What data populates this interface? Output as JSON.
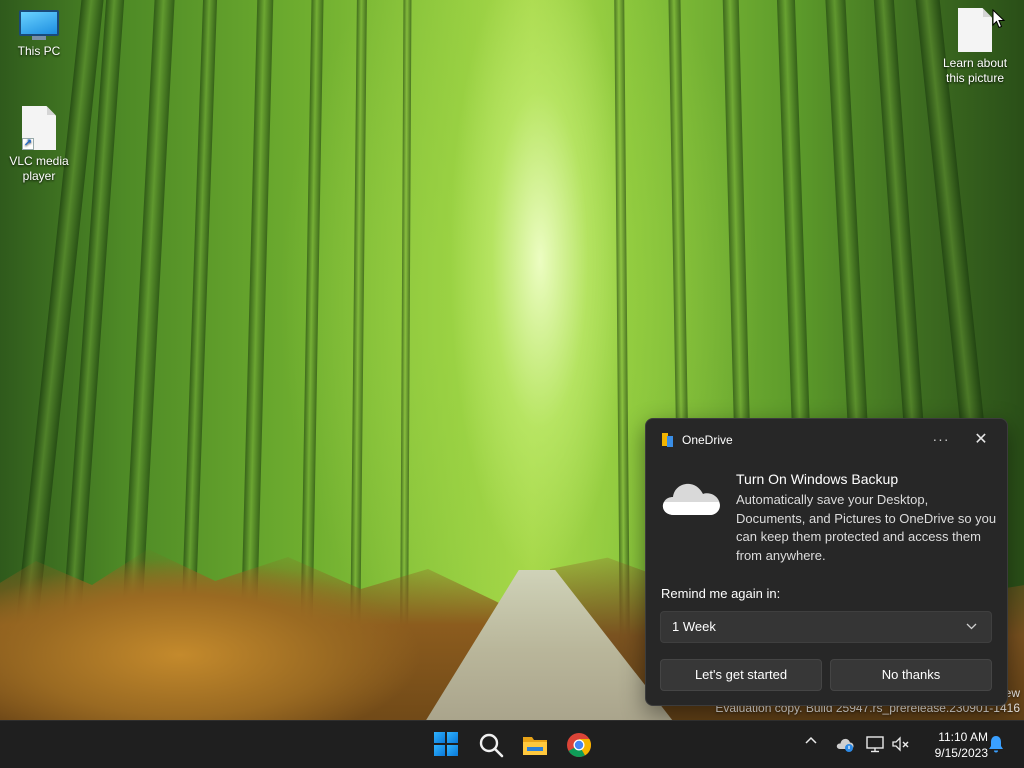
{
  "desktop": {
    "icons": [
      {
        "label": "This PC",
        "icon": "this-pc-icon"
      },
      {
        "label": "VLC media player",
        "icon": "vlc-shortcut-icon"
      },
      {
        "label": "Learn about this picture",
        "icon": "file-icon"
      }
    ]
  },
  "watermark": {
    "line1": "ew",
    "line2": "Evaluation copy. Build 25947.rs_prerelease.230901-1416"
  },
  "toast": {
    "app_name": "OneDrive",
    "more_label": "···",
    "close_label": "✕",
    "title": "Turn On Windows Backup",
    "body": "Automatically save your Desktop, Documents, and Pictures to OneDrive so you can keep them protected and access them from anywhere.",
    "remind_label": "Remind me again in:",
    "remind_selected": "1 Week",
    "primary_button": "Let's get started",
    "secondary_button": "No thanks"
  },
  "taskbar": {
    "pinned": [
      "start-icon",
      "search-icon",
      "file-explorer-icon",
      "chrome-icon"
    ],
    "tray_chevron": "^",
    "tray_icons": [
      "onedrive-tray-icon",
      "network-icon",
      "volume-muted-icon"
    ],
    "time": "11:10 AM",
    "date": "9/15/2023"
  },
  "colors": {
    "toast_bg": "#272727",
    "taskbar_bg": "#1f1f1f",
    "accent": "#0a78d8"
  }
}
